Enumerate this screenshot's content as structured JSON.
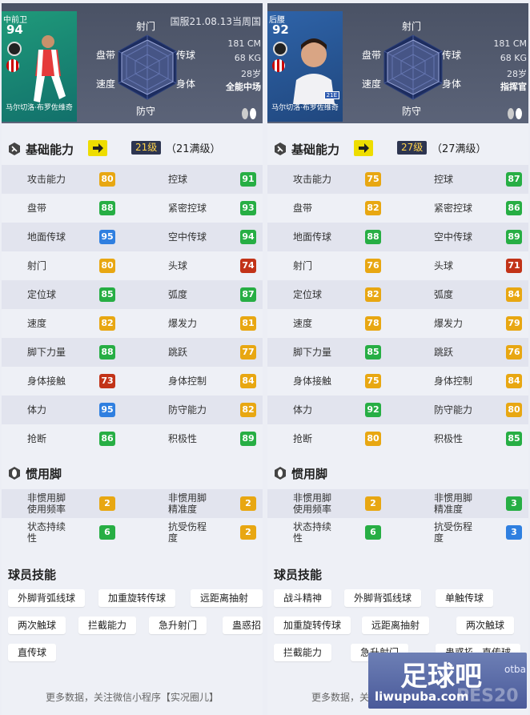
{
  "colors": {
    "green": "#27ae44",
    "orange": "#e8a712",
    "blue": "#2f7fe0",
    "red": "#c23318",
    "yellow": "#e6d400"
  },
  "radar_labels": {
    "top": "射门",
    "tl": "盘带",
    "tr": "传球",
    "ml": "速度",
    "mr": "身体",
    "bottom": "防守"
  },
  "ability": {
    "title": "基础能力"
  },
  "foot": {
    "title": "惯用脚"
  },
  "skills": {
    "title": "球员技能"
  },
  "footer": {
    "text": "更多数据，关注微信小程序【实况圈儿】"
  },
  "watermark": {
    "brand": "足球吧",
    "url": "liwupuba.com",
    "small": "otba",
    "pes": "PES20"
  },
  "players": [
    {
      "position": "中前卫",
      "overall": "94",
      "name": "马尔切洛·布罗佐维奇",
      "server": "国服21.08.13当周国",
      "height": "181 CM",
      "weight": "68 KG",
      "age": "28岁",
      "style": "全能中场",
      "level": "21级",
      "level_max": "（21满级）",
      "stats": [
        [
          "攻击能力",
          "80",
          "orange"
        ],
        [
          "控球",
          "91",
          "green"
        ],
        [
          "盘带",
          "88",
          "green"
        ],
        [
          "紧密控球",
          "93",
          "green"
        ],
        [
          "地面传球",
          "95",
          "blue"
        ],
        [
          "空中传球",
          "94",
          "green"
        ],
        [
          "射门",
          "80",
          "orange"
        ],
        [
          "头球",
          "74",
          "red"
        ],
        [
          "定位球",
          "85",
          "green"
        ],
        [
          "弧度",
          "87",
          "green"
        ],
        [
          "速度",
          "82",
          "orange"
        ],
        [
          "爆发力",
          "81",
          "orange"
        ],
        [
          "脚下力量",
          "88",
          "green"
        ],
        [
          "跳跃",
          "77",
          "orange"
        ],
        [
          "身体接触",
          "73",
          "red"
        ],
        [
          "身体控制",
          "84",
          "orange"
        ],
        [
          "体力",
          "95",
          "blue"
        ],
        [
          "防守能力",
          "82",
          "orange"
        ],
        [
          "抢断",
          "86",
          "green"
        ],
        [
          "积极性",
          "89",
          "green"
        ]
      ],
      "foot": [
        [
          "非惯用脚\n使用频率",
          "2",
          "orange"
        ],
        [
          "非惯用脚\n精准度",
          "2",
          "orange"
        ],
        [
          "状态持续\n性",
          "6",
          "green"
        ],
        [
          "抗受伤程\n度",
          "2",
          "orange"
        ]
      ],
      "skills": [
        [
          "外脚背弧线球",
          "加重旋转传球",
          "远距离抽射"
        ],
        [
          "两次触球",
          "拦截能力",
          "急升射门",
          "蛊惑招"
        ],
        [
          "直传球"
        ]
      ]
    },
    {
      "position": "后腰",
      "overall": "92",
      "name": "马尔切洛·布罗佐维奇",
      "server": "",
      "height": "181 CM",
      "weight": "68 KG",
      "age": "28岁",
      "style": "指挥官",
      "level": "27级",
      "level_max": "（27满级）",
      "stats": [
        [
          "攻击能力",
          "75",
          "orange"
        ],
        [
          "控球",
          "87",
          "green"
        ],
        [
          "盘带",
          "82",
          "orange"
        ],
        [
          "紧密控球",
          "86",
          "green"
        ],
        [
          "地面传球",
          "88",
          "green"
        ],
        [
          "空中传球",
          "89",
          "green"
        ],
        [
          "射门",
          "76",
          "orange"
        ],
        [
          "头球",
          "71",
          "red"
        ],
        [
          "定位球",
          "82",
          "orange"
        ],
        [
          "弧度",
          "84",
          "orange"
        ],
        [
          "速度",
          "78",
          "orange"
        ],
        [
          "爆发力",
          "79",
          "orange"
        ],
        [
          "脚下力量",
          "85",
          "green"
        ],
        [
          "跳跃",
          "76",
          "orange"
        ],
        [
          "身体接触",
          "75",
          "orange"
        ],
        [
          "身体控制",
          "84",
          "orange"
        ],
        [
          "体力",
          "92",
          "green"
        ],
        [
          "防守能力",
          "80",
          "orange"
        ],
        [
          "抢断",
          "80",
          "orange"
        ],
        [
          "积极性",
          "85",
          "green"
        ]
      ],
      "foot": [
        [
          "非惯用脚\n使用频率",
          "2",
          "orange"
        ],
        [
          "非惯用脚\n精准度",
          "3",
          "green"
        ],
        [
          "状态持续\n性",
          "6",
          "green"
        ],
        [
          "抗受伤程\n度",
          "3",
          "blue"
        ]
      ],
      "skills": [
        [
          "战斗精神",
          "外脚背弧线球",
          "单触传球"
        ],
        [
          "加重旋转传球",
          "远距离抽射",
          "两次触球"
        ],
        [
          "拦截能力",
          "急升射门",
          "蛊惑招",
          "直传球"
        ]
      ]
    }
  ]
}
